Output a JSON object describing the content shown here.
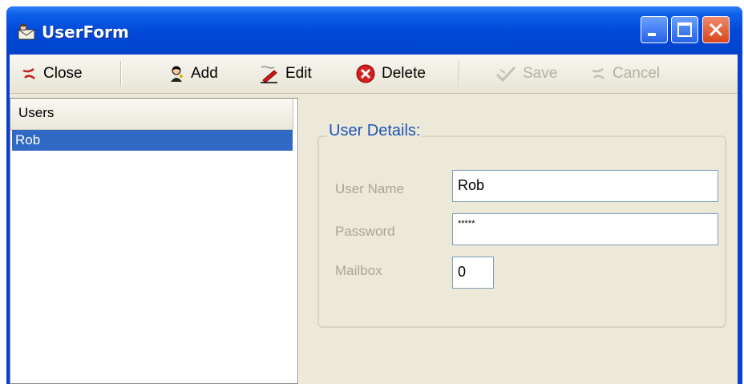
{
  "window": {
    "title": "UserForm"
  },
  "toolbar": {
    "close_label": "Close",
    "add_label": "Add",
    "edit_label": "Edit",
    "delete_label": "Delete",
    "save_label": "Save",
    "cancel_label": "Cancel"
  },
  "users_list": {
    "header": "Users",
    "items": [
      "Rob"
    ],
    "selected": "Rob"
  },
  "details": {
    "group_title": "User Details:",
    "username_label": "User Name",
    "username_value": "Rob",
    "password_label": "Password",
    "password_value": "*****",
    "mailbox_label": "Mailbox",
    "mailbox_value": "0"
  },
  "colors": {
    "titlebar": "#0044cc",
    "selection": "#316ac5",
    "group_title": "#1f52b8",
    "disabled_text": "#b3b0a3"
  }
}
